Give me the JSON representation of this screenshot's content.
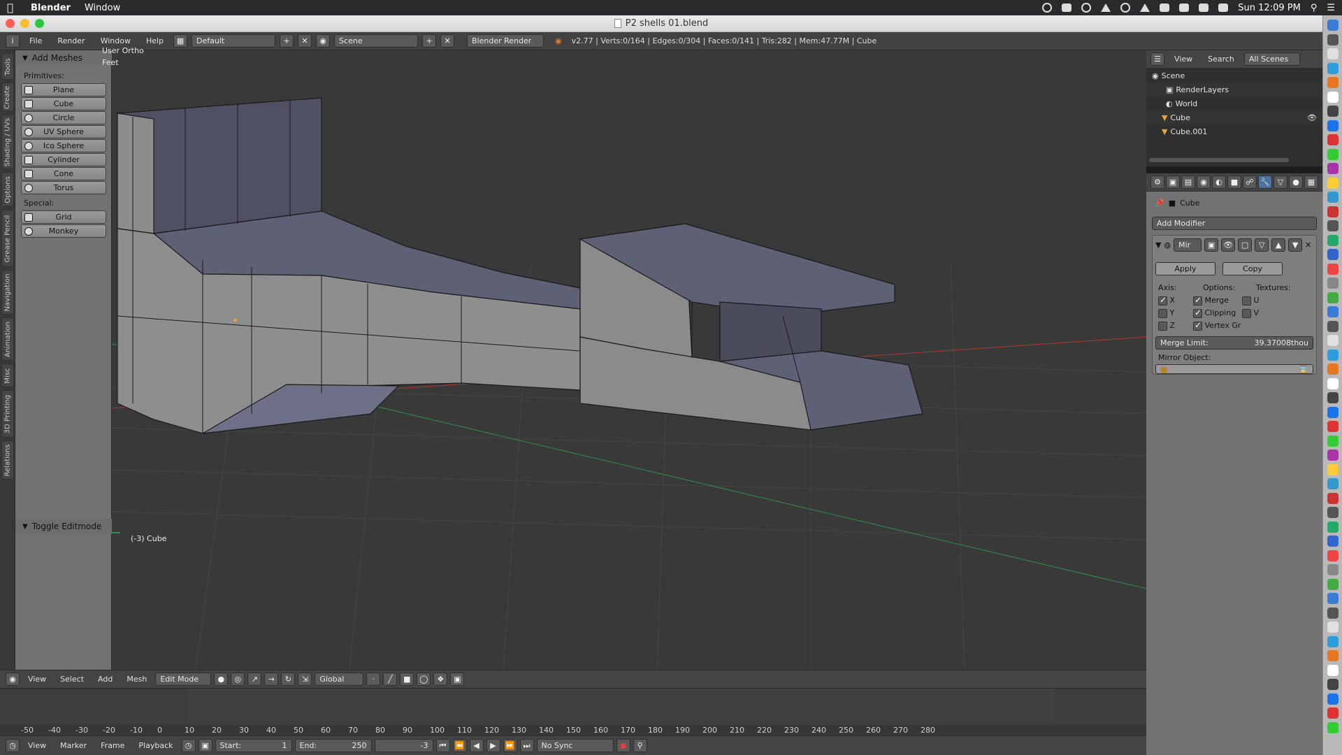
{
  "mac_menubar": {
    "app_name": "Blender",
    "menus": [
      "Window"
    ],
    "clock": "Sun 12:09 PM"
  },
  "window": {
    "title": "P2 shells 01.blend"
  },
  "info_header": {
    "menus": [
      "File",
      "Render",
      "Window",
      "Help"
    ],
    "screen_layout": "Default",
    "scene": "Scene",
    "render_engine": "Blender Render",
    "stats": "v2.77 | Verts:0/164 | Edges:0/304 | Faces:0/141 | Tris:282 | Mem:47.77M | Cube"
  },
  "side_tabs": [
    "Tools",
    "Create",
    "Shading / UVs",
    "Options",
    "Grease Pencil",
    "Navigation",
    "Animation",
    "Misc",
    "3D Printing",
    "Relations"
  ],
  "tool_shelf": {
    "panel_title": "Add Meshes",
    "primitives_label": "Primitives:",
    "primitives": [
      "Plane",
      "Cube",
      "Circle",
      "UV Sphere",
      "Ico Sphere",
      "Cylinder",
      "Cone",
      "Torus"
    ],
    "special_label": "Special:",
    "special": [
      "Grid",
      "Monkey"
    ],
    "toggle_editmode": "Toggle Editmode"
  },
  "viewport": {
    "view_name": "User Ortho",
    "units": "Feet",
    "object_label": "(-3) Cube"
  },
  "view3d_header": {
    "menus": [
      "View",
      "Select",
      "Add",
      "Mesh"
    ],
    "mode": "Edit Mode",
    "orientation": "Global"
  },
  "timeline": {
    "ticks": [
      "-50",
      "-40",
      "-30",
      "-20",
      "-10",
      "0",
      "10",
      "20",
      "30",
      "40",
      "50",
      "60",
      "70",
      "80",
      "90",
      "100",
      "110",
      "120",
      "130",
      "140",
      "150",
      "160",
      "170",
      "180",
      "190",
      "200",
      "210",
      "220",
      "230",
      "240",
      "250",
      "260",
      "270",
      "280"
    ],
    "current_frame": 0,
    "footer_menus": [
      "View",
      "Marker",
      "Frame",
      "Playback"
    ],
    "start_label": "Start:",
    "start_value": "1",
    "end_label": "End:",
    "end_value": "250",
    "current_value": "-3",
    "sync": "No Sync"
  },
  "outliner": {
    "header_menus": [
      "View",
      "Search"
    ],
    "scope": "All Scenes",
    "rows": [
      "Scene",
      "RenderLayers",
      "World",
      "Cube",
      "Cube.001"
    ]
  },
  "properties": {
    "context_object": "Cube",
    "add_modifier": "Add Modifier",
    "modifier_name": "Mir",
    "apply": "Apply",
    "copy": "Copy",
    "axis_label": "Axis:",
    "options_label": "Options:",
    "textures_label": "Textures:",
    "axis": [
      {
        "label": "X",
        "checked": true
      },
      {
        "label": "Y",
        "checked": false
      },
      {
        "label": "Z",
        "checked": false
      }
    ],
    "options": [
      {
        "label": "Merge",
        "checked": true
      },
      {
        "label": "Clipping",
        "checked": true
      },
      {
        "label": "Vertex Gr",
        "checked": true
      }
    ],
    "textures": [
      {
        "label": "U",
        "checked": false
      },
      {
        "label": "V",
        "checked": false
      }
    ],
    "merge_limit_label": "Merge Limit:",
    "merge_limit_value": "39.37008thou",
    "mirror_object_label": "Mirror Object:"
  },
  "colors": {
    "viewport_bg": "#393939",
    "mesh_face": "#8a8a8a",
    "selected_face": "#7b7d9a",
    "x_axis": "#c0392b",
    "y_axis": "#2fa84f",
    "frame_marker": "#2fcf3f"
  }
}
